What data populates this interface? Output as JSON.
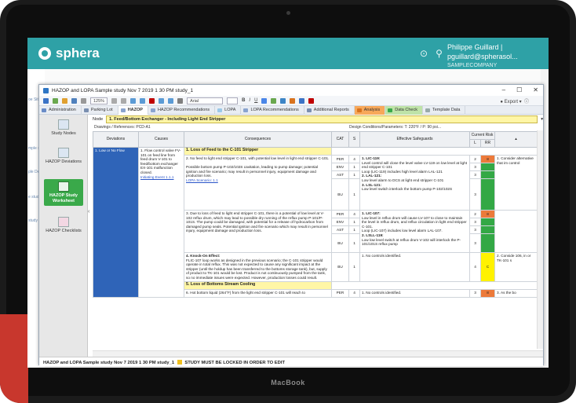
{
  "device": {
    "brand": "MacBook"
  },
  "portal": {
    "logo_text": "sphera",
    "user_name": "Philippe Guillard | pguillard@spherasol...",
    "company": "SAMPLECOMPANY",
    "help_icon": "help-circle-icon",
    "user_icon": "user-icon"
  },
  "window": {
    "title": "HAZOP and LOPA Sample  study Nov 7 2019 1 30 PM study_1",
    "controls": [
      "–",
      "☐",
      "✕"
    ]
  },
  "toolbar": {
    "zoom": "125%",
    "font": "Arial",
    "export_label": "Export"
  },
  "ribbon": {
    "tabs": [
      {
        "label": "Administration",
        "color": "#6a8cc7"
      },
      {
        "label": "Parking Lot",
        "color": "#7a8fb0"
      },
      {
        "label": "HAZOP",
        "color": "#8aa4cf"
      },
      {
        "label": "HAZOP Recommendations",
        "color": "#8aa4cf"
      },
      {
        "label": "LOPA",
        "color": "#9cc9e8"
      },
      {
        "label": "LOPA Recommendations",
        "color": "#8aa4cf"
      },
      {
        "label": "Additional Reports",
        "color": "#7a8fb0"
      },
      {
        "label": "Analysis",
        "color": "#d9731e"
      },
      {
        "label": "Data Check",
        "color": "#3aa94a"
      },
      {
        "label": "Template Data",
        "color": "#9aa"
      }
    ],
    "active_index": 2
  },
  "sidenav": {
    "items": [
      {
        "label": "Study Nodes",
        "active": false
      },
      {
        "label": "HAZOP Deviations",
        "active": false
      },
      {
        "label": "HAZOP Study Worksheet",
        "active": true
      },
      {
        "label": "HAZOP Checklists",
        "active": false
      }
    ]
  },
  "node": {
    "label": "Node",
    "value": "1. Feed/Bottom Exchanger - Including Light End Stripper",
    "drawings_label": "Drawings / References:",
    "drawings_value": "PCD-A1",
    "design_label": "Design Conditions/Parameters:",
    "design_value": "T: 220°F / P: 90 psi..."
  },
  "grid": {
    "headers": {
      "deviations": "Deviations",
      "causes": "Causes",
      "consequences": "Consequences",
      "cat": "CAT",
      "s": "S",
      "safeguards": "Effective Safeguards",
      "current_risk": "Current Risk",
      "l": "L",
      "rr": "RR"
    },
    "deviation": "1. Low or No Flow",
    "cause": "1. Flow control valve FV-101 on feed line from feed drum V-101 to feed/bottom exchanger EX-101 malfunction closed.",
    "cause_link": "Initiating Event 1.1.1",
    "section1": "1. Loss of Feed to the C-101 Stripper",
    "cons2": "2. No feed to light end stripper C-101, with potential low level in light end stripper C-101.",
    "cons2b": "Possible bottom pump P-102/102S cavitation, leading to pump damage; potential ignition and fire scenario; may result in personnel injury, equipment damage and production loss.",
    "cons2_link": "LOPA Scenario: 1.1",
    "cons3": "3. Due to loss of feed to light end stripper C-101, there is a potential of low level at V-102 reflux drum, which may lead to possible dry running of the reflux pump P-101/P-101S. The pump could be damaged, with potential for a release of hydrocarbon from damaged pump seals. Potential ignition and fire scenario which may result in personnel injury, equipment damage and production loss.",
    "cons4_title": "4. Knock-On Effect:",
    "cons4": "FLIC-107 loop works as designed in the previous scenario; the C-101 stripper would operate in total reflux. This was not expected to cause any significant impact at the stripper (until the holdup has been transferred to the bottoms storage tank), but, supply of product to TK-101 would be lost. Product is not continuously pumped from the tank, so no immediate issues were expected. However, production losses could result.",
    "section5": "5. Loss of Bottoms Stream Cooling",
    "cons6": "6. Hot bottom liquid (264°F) from the light end stripper C-101 will reach to",
    "cats": [
      "PER",
      "ENV",
      "AST",
      "BU",
      "PER",
      "ENV",
      "AST",
      "BU",
      "BU",
      "PER"
    ],
    "sevs": [
      "4",
      "1",
      "1",
      "1",
      "4",
      "1",
      "1",
      "1",
      "1",
      "4"
    ],
    "safeguard1_t": "1. LIC-119:",
    "safeguard1": "Level control will close the level valve LV-119 on low level at light end stripper C-101",
    "safeguard1b": "Loop (LIC-119) includes high level alarm LAL-121",
    "safeguard2_t": "2. LAL-121:",
    "safeguard2": "Low level alarm to DCS at light end stripper C-101",
    "safeguard3_t": "3. LSL-121:",
    "safeguard3": "Low level switch interlock the bottom pump P-102/102S",
    "safeguard4_t": "1. LIC-107:",
    "safeguard4": "Low level in reflux drum will cause LV-107 to close to maintain the level in reflux drum, and reflux circulation in light end stripper C-101.",
    "safeguard4b": "Loop (LIC-107) includes low level alarm LAL-107.",
    "safeguard5_t": "2. LSLL-119:",
    "safeguard5": "Low low level switch at reflux drum V-102 will interlock the P-101/101S reflux pump",
    "safeguard6": "1. No controls identified.",
    "safeguard7": "1. No controls identified.",
    "risks": [
      [
        "2",
        "8"
      ],
      [
        "3",
        ""
      ],
      [
        "3",
        ""
      ],
      [
        "3",
        ""
      ],
      [
        "2",
        "8"
      ],
      [
        "3",
        ""
      ],
      [
        "3",
        ""
      ],
      [
        "3",
        ""
      ],
      [
        "4",
        "C"
      ],
      [
        "3",
        "8"
      ]
    ],
    "recs": [
      "1. Consider alternative that im control",
      "2. Conside 106, in or TK-101 s",
      "3. As the bo"
    ]
  },
  "statusbar": {
    "study": "HAZOP and LOPA Sample  study Nov 7 2019 1 30 PM study_1",
    "warning": "STUDY MUST BE LOCKED IN ORDER TO EDIT"
  },
  "colors": {
    "brand": "#2ea1a6",
    "deviation": "#2f64b8",
    "highlight": "#fff6a6",
    "risk_high": "#ec7a3a",
    "risk_low": "#33a845",
    "risk_med": "#fff200"
  }
}
